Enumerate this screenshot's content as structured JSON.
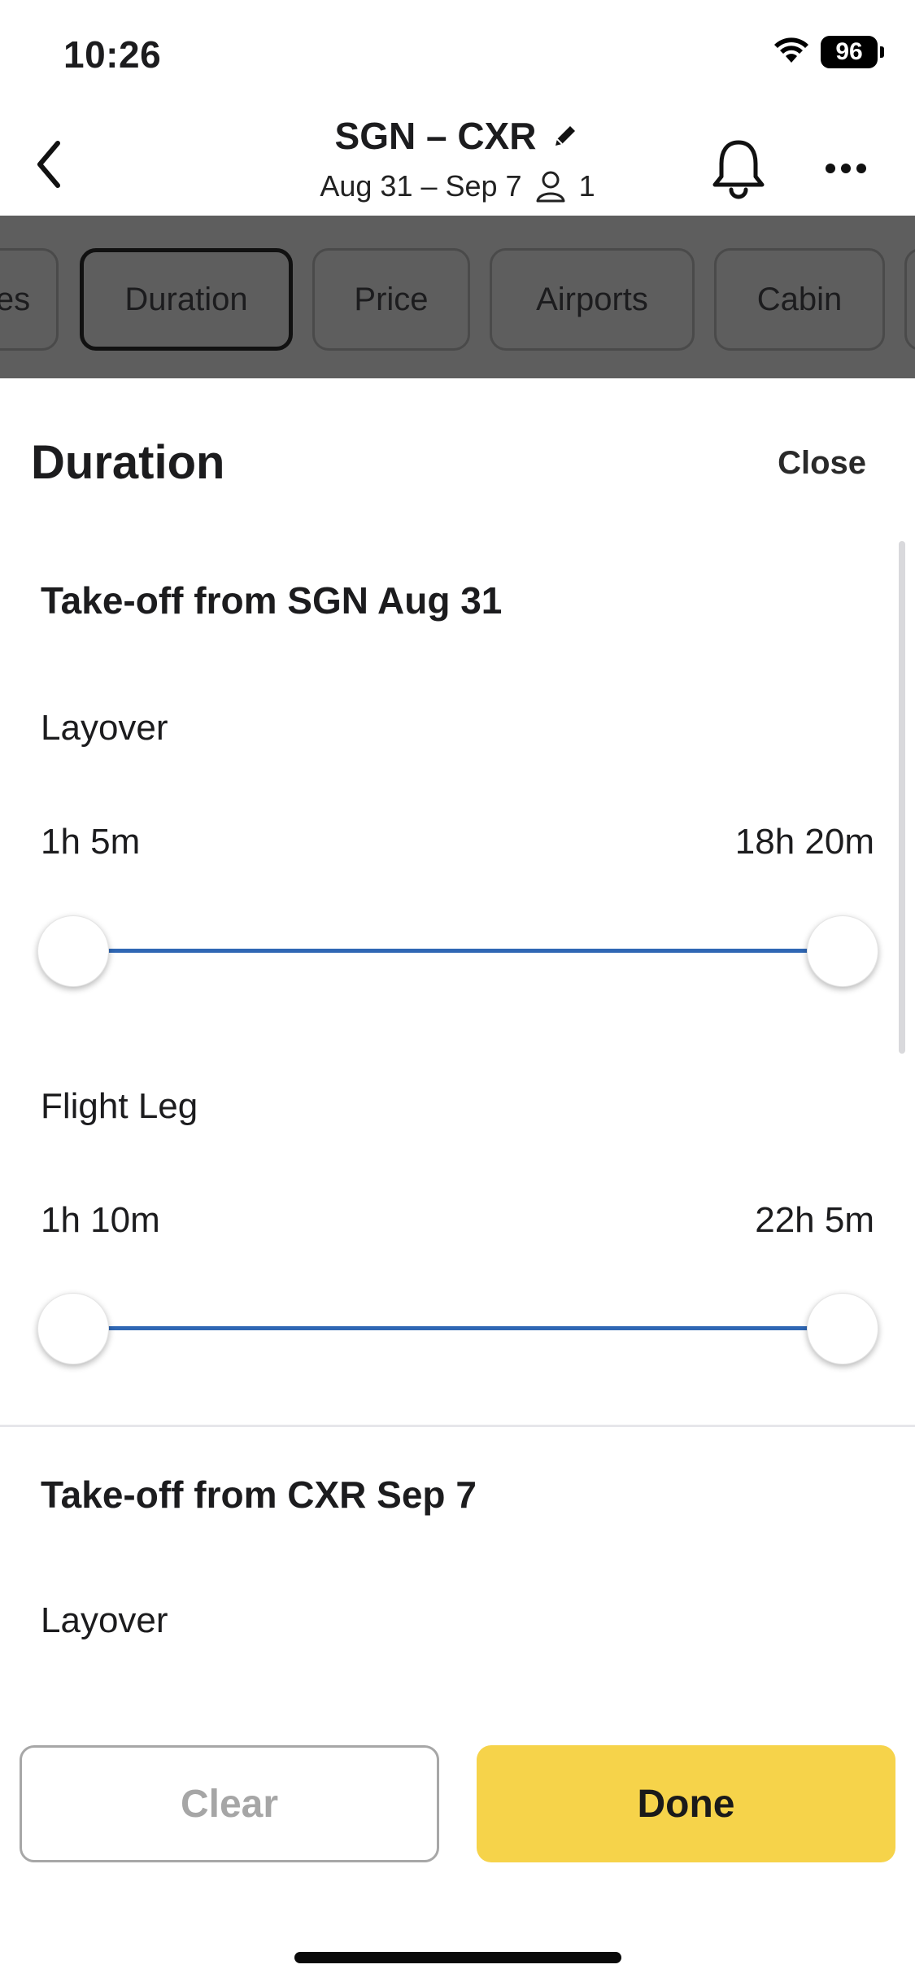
{
  "status_bar": {
    "time": "10:26",
    "battery": "96"
  },
  "header": {
    "route": "SGN – CXR",
    "dates": "Aug 31 – Sep 7",
    "travelers": "1"
  },
  "filter_chips": [
    {
      "label": "es"
    },
    {
      "label": "Duration",
      "active": true
    },
    {
      "label": "Price"
    },
    {
      "label": "Airports"
    },
    {
      "label": "Cabin"
    }
  ],
  "sheet": {
    "title": "Duration",
    "close_label": "Close",
    "outbound": {
      "title": "Take-off from SGN Aug 31",
      "layover": {
        "label": "Layover",
        "min": "1h 5m",
        "max": "18h 20m",
        "selected_start": 0,
        "selected_end": 1
      },
      "flight_leg": {
        "label": "Flight Leg",
        "min": "1h 10m",
        "max": "22h 5m",
        "selected_start": 0,
        "selected_end": 1
      }
    },
    "return": {
      "title": "Take-off from CXR Sep 7",
      "layover": {
        "label": "Layover"
      }
    }
  },
  "footer": {
    "clear_label": "Clear",
    "done_label": "Done"
  },
  "colors": {
    "accent": "#f6d34a",
    "slider": "#2f67b4",
    "overlay": "#5e5e5e"
  },
  "icons": [
    "wifi-icon",
    "battery-icon",
    "back-icon",
    "edit-icon",
    "person-icon",
    "bell-icon",
    "more-icon"
  ]
}
